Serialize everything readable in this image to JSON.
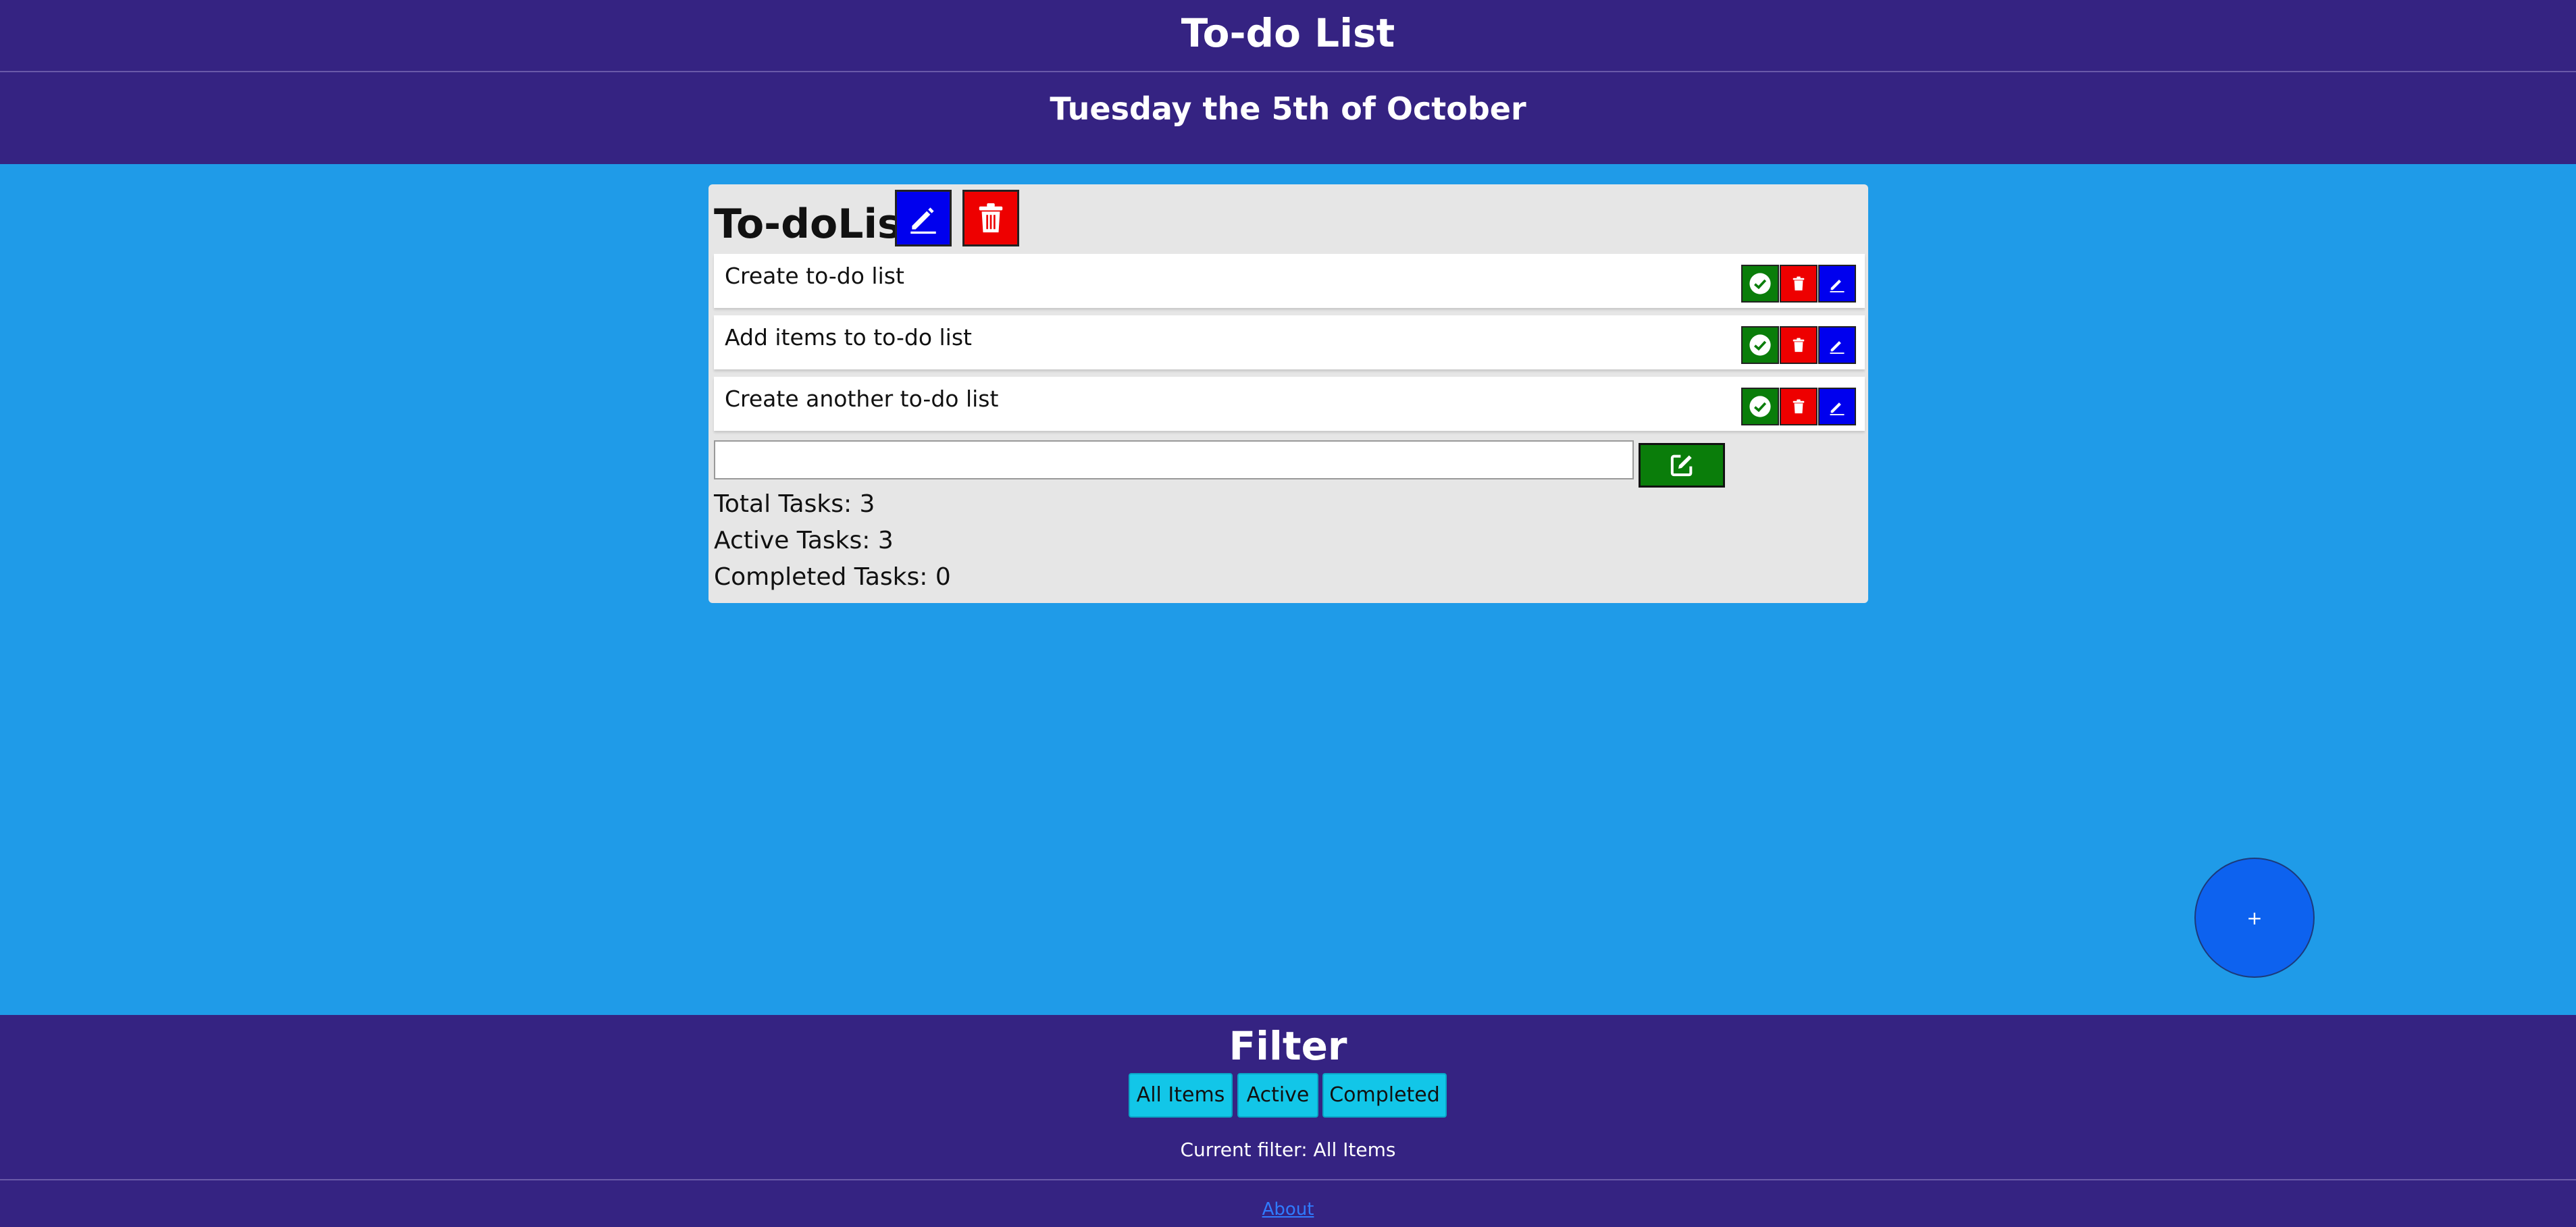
{
  "header": {
    "title": "To-do List",
    "date": "Tuesday the 5th of October"
  },
  "list": {
    "name": "To-doList",
    "tasks": [
      {
        "text": "Create to-do list"
      },
      {
        "text": "Add items to to-do list"
      },
      {
        "text": "Create another to-do list"
      }
    ],
    "new_task_value": "",
    "stats": {
      "total": "Total Tasks: 3",
      "active": "Active Tasks: 3",
      "completed": "Completed Tasks: 0"
    }
  },
  "fab": {
    "label": "+"
  },
  "filter": {
    "title": "Filter",
    "buttons": [
      "All Items",
      "Active",
      "Completed"
    ],
    "current": "Current filter: All Items"
  },
  "footer": {
    "about": "About"
  },
  "colors": {
    "bar": "#352382",
    "background": "#1f9be8",
    "done_button": "#0a7d0a",
    "delete_button": "#ee0000",
    "edit_button": "#0000ee",
    "filter_button": "#12c6e8"
  },
  "icons": {
    "list_edit": "pencil-icon",
    "list_delete": "trash-icon",
    "task_done": "check-circle-icon",
    "task_delete": "trash-icon",
    "task_edit": "pencil-icon",
    "add_task": "edit-square-icon"
  }
}
